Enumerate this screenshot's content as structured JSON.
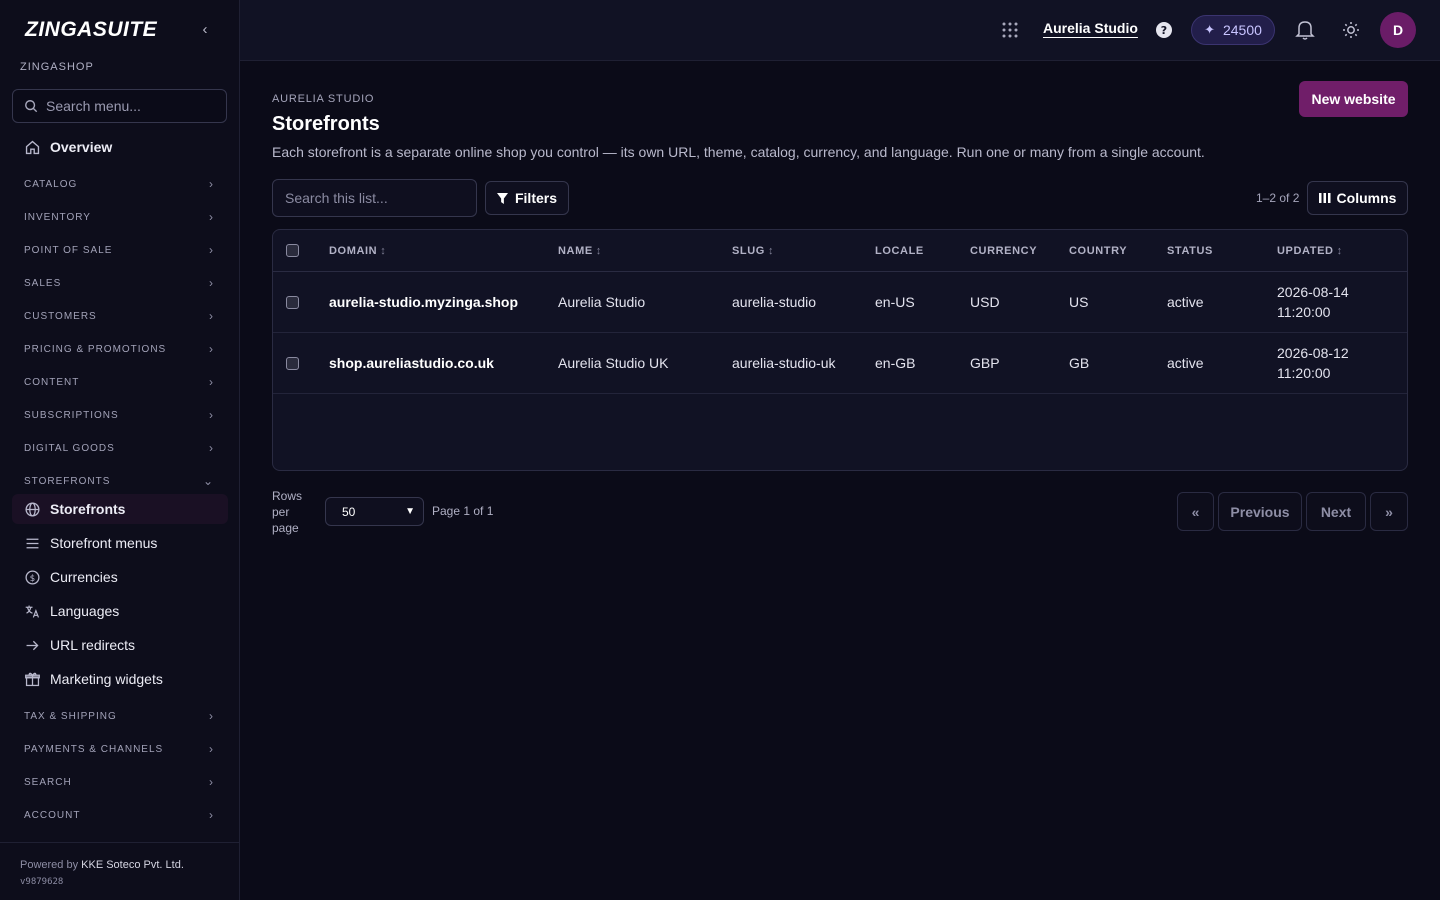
{
  "sidebar": {
    "brand": "ZINGASUITE",
    "org": "ZINGASHOP",
    "search_placeholder": "Search menu...",
    "overview": "Overview",
    "groups_top": [
      "CATALOG",
      "INVENTORY",
      "POINT OF SALE",
      "SALES",
      "CUSTOMERS",
      "PRICING & PROMOTIONS",
      "CONTENT",
      "SUBSCRIPTIONS",
      "DIGITAL GOODS"
    ],
    "storefronts_group": "STOREFRONTS",
    "storefront_items": [
      "Storefronts",
      "Storefront menus",
      "Currencies",
      "Languages",
      "URL redirects",
      "Marketing widgets"
    ],
    "groups_bottom": [
      "TAX & SHIPPING",
      "PAYMENTS & CHANNELS",
      "SEARCH",
      "ACCOUNT"
    ],
    "footer_prefix": "Powered by",
    "footer_company": "KKE Soteco Pvt. Ltd.",
    "version": "v9879628"
  },
  "topbar": {
    "store_name": "Aurelia Studio",
    "credits": "24500",
    "avatar_initial": "D"
  },
  "page": {
    "breadcrumb": "AURELIA STUDIO",
    "title": "Storefronts",
    "description": "Each storefront is a separate online shop you control — its own URL, theme, catalog, currency, and language. Run one or many from a single account.",
    "new_button": "New website",
    "search_placeholder": "Search this list...",
    "filters_label": "Filters",
    "count": "1–2 of 2",
    "columns_label": "Columns"
  },
  "table": {
    "headers": [
      "DOMAIN",
      "NAME",
      "SLUG",
      "LOCALE",
      "CURRENCY",
      "COUNTRY",
      "STATUS",
      "UPDATED"
    ],
    "sortable": [
      true,
      true,
      true,
      false,
      false,
      false,
      false,
      true
    ],
    "rows": [
      {
        "domain": "aurelia-studio.myzinga.shop",
        "name": "Aurelia Studio",
        "slug": "aurelia-studio",
        "locale": "en-US",
        "currency": "USD",
        "country": "US",
        "status": "active",
        "updated_date": "2026-08-14",
        "updated_time": "11:20:00"
      },
      {
        "domain": "shop.aureliastudio.co.uk",
        "name": "Aurelia Studio UK",
        "slug": "aurelia-studio-uk",
        "locale": "en-GB",
        "currency": "GBP",
        "country": "GB",
        "status": "active",
        "updated_date": "2026-08-12",
        "updated_time": "11:20:00"
      }
    ]
  },
  "pagination": {
    "rows_label": "Rows per page",
    "rows_value": "50",
    "page_info": "Page 1 of 1",
    "first": "«",
    "previous": "Previous",
    "next": "Next",
    "last": "»"
  },
  "colors": {
    "accent": "#701e69",
    "avatar": "#6a1c67",
    "credits_bg": "#221e4a"
  }
}
